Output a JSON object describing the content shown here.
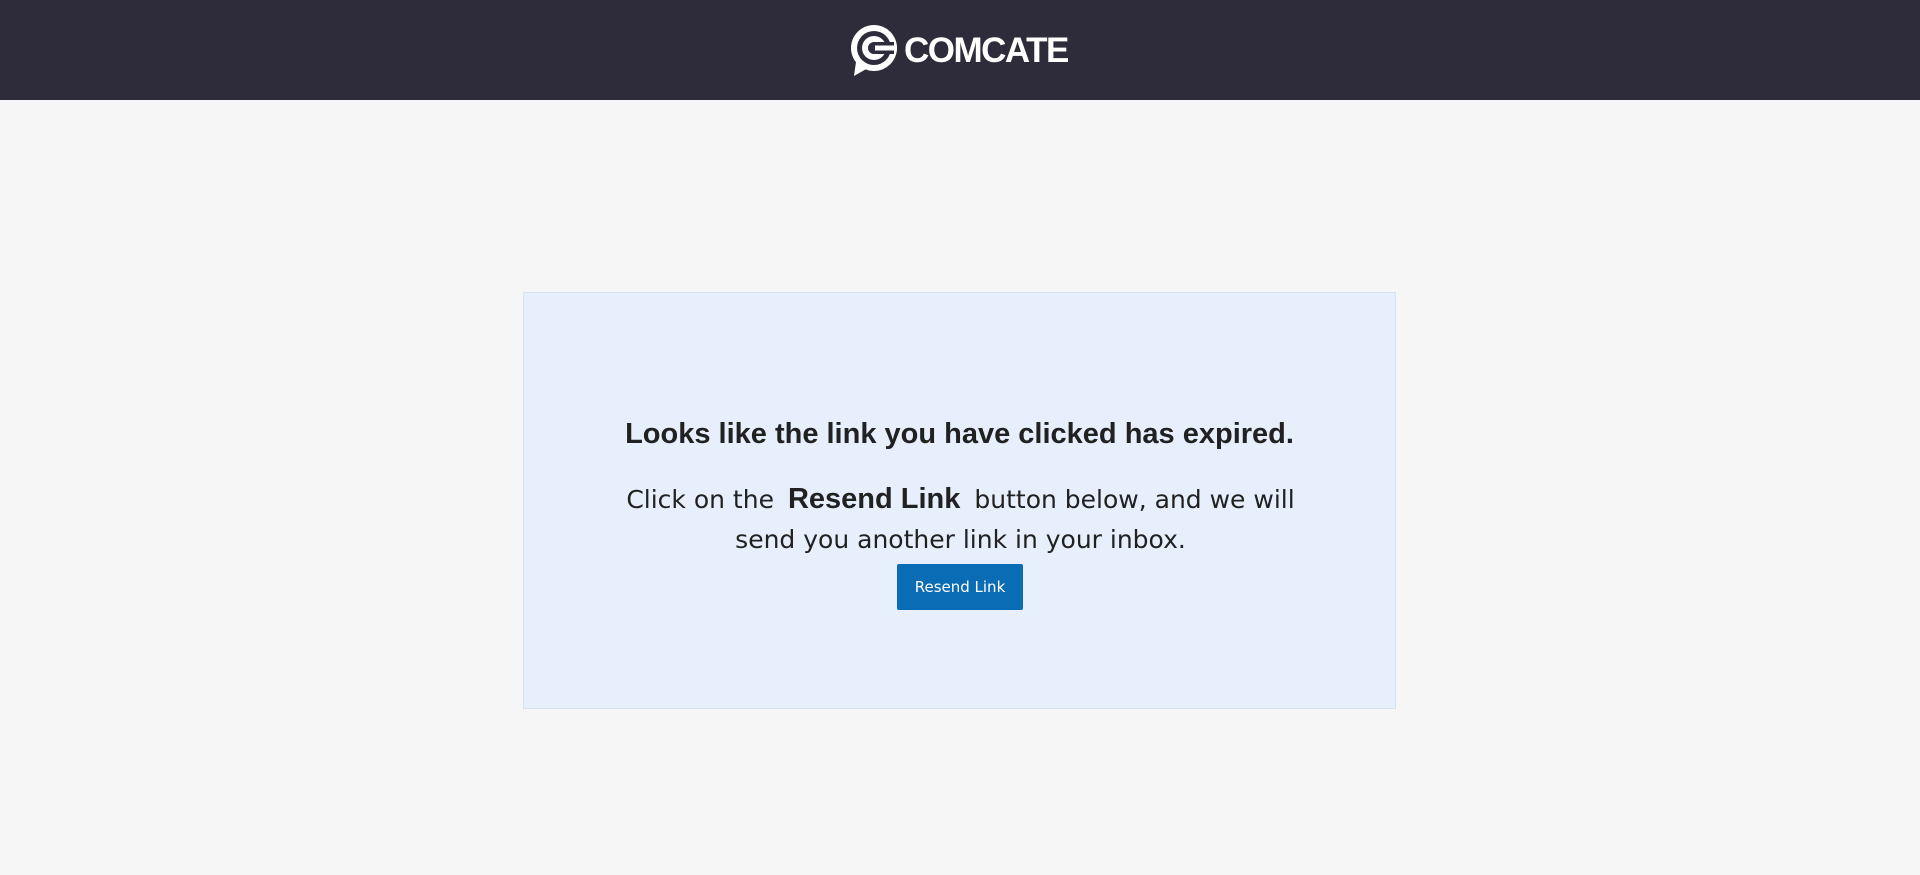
{
  "header": {
    "brand_name": "COMCATE",
    "background_color": "#2e2c3a",
    "logo_icon": "comcate-speech-c-icon"
  },
  "card": {
    "title": "Looks like the link you have clicked has expired.",
    "message_before": "Click on the",
    "message_highlight": "Resend Link",
    "message_after": "button below, and we will send you another link in your inbox.",
    "button_label": "Resend Link",
    "background_color": "#e7effc",
    "button_color": "#0a6cb4"
  },
  "page": {
    "background_color": "#f6f6f6"
  }
}
